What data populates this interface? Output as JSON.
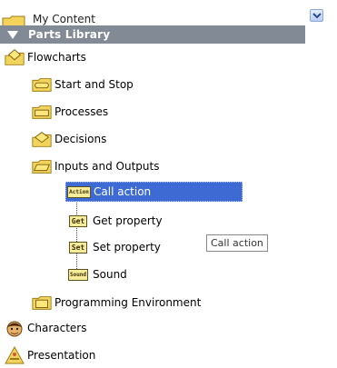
{
  "top_item": {
    "label": "My Content",
    "icon": "folder-icon"
  },
  "header": {
    "title": "Parts Library",
    "icon": "collapse-triangle-icon"
  },
  "tree": {
    "flowcharts": {
      "label": "Flowcharts",
      "icon": "diamond-folder-icon"
    },
    "start_stop": {
      "label": "Start and Stop",
      "icon": "folder-icon"
    },
    "processes": {
      "label": "Processes",
      "icon": "folder-icon"
    },
    "decisions": {
      "label": "Decisions",
      "icon": "diamond-folder-icon"
    },
    "inputs_outputs": {
      "label": "Inputs and Outputs",
      "icon": "folder-icon"
    },
    "call_action": {
      "label": "Call action",
      "badge": "Action",
      "selected": true
    },
    "get_property": {
      "label": "Get property",
      "badge": "Get"
    },
    "set_property": {
      "label": "Set property",
      "badge": "Set"
    },
    "sound": {
      "label": "Sound",
      "badge": "Sound"
    },
    "programming_environment": {
      "label": "Programming Environment",
      "icon": "folder-icon"
    },
    "characters": {
      "label": "Characters",
      "icon": "character-face-icon"
    },
    "presentation": {
      "label": "Presentation",
      "icon": "presentation-icon"
    }
  },
  "tooltip": {
    "text": "Call action"
  },
  "colors": {
    "header_bg": "#828a96",
    "selected_bg": "#3d6bd3",
    "folder": "#f2d45c"
  }
}
